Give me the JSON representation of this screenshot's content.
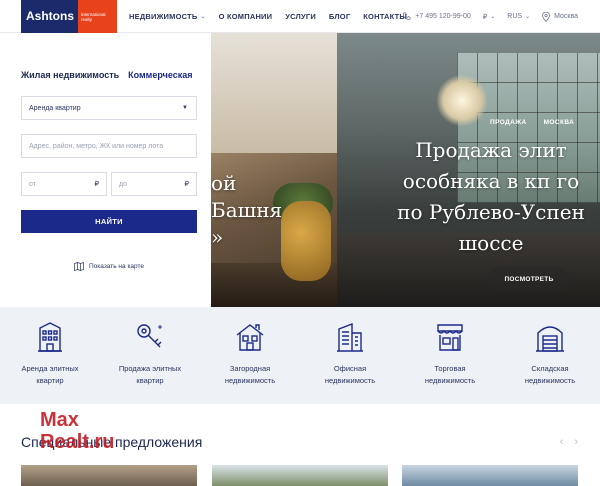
{
  "logo": {
    "name": "Ashtons",
    "tagline": "international realty"
  },
  "nav": [
    {
      "label": "НЕДВИЖИМОСТЬ",
      "dropdown": true
    },
    {
      "label": "О КОМПАНИИ",
      "dropdown": false
    },
    {
      "label": "УСЛУГИ",
      "dropdown": false
    },
    {
      "label": "БЛОГ",
      "dropdown": false
    },
    {
      "label": "КОНТАКТЫ",
      "dropdown": false
    }
  ],
  "header": {
    "phone": "+7 495 120-99-00",
    "currency": "₽",
    "language": "RUS",
    "city": "Москва"
  },
  "search": {
    "tab_residential": "Жилая недвижимость",
    "tab_commercial": "Коммерческая",
    "type_value": "Аренда квартир",
    "address_placeholder": "Адрес, район, метро, ЖК или номер лота",
    "from_placeholder": "от",
    "to_placeholder": "до",
    "currency": "₽",
    "submit": "НАЙТИ",
    "map_link": "Показать на карте"
  },
  "hero": {
    "left_lines": [
      "ой",
      "Башня",
      "»"
    ],
    "tag_deal": "ПРОДАЖА",
    "tag_city": "МОСКВА",
    "title_lines": [
      "Продажа элит",
      "особняка в кп го",
      "по Рублево-Успен",
      "шоссе"
    ],
    "button": "ПОСМОТРЕТЬ"
  },
  "categories": [
    {
      "line1": "Аренда элитных",
      "line2": "квартир",
      "icon": "apartment-building-icon"
    },
    {
      "line1": "Продажа элитных",
      "line2": "квартир",
      "icon": "key-icon"
    },
    {
      "line1": "Загородная",
      "line2": "недвижимость",
      "icon": "house-icon"
    },
    {
      "line1": "Офисная",
      "line2": "недвижимость",
      "icon": "office-building-icon"
    },
    {
      "line1": "Торговая",
      "line2": "недвижимость",
      "icon": "storefront-icon"
    },
    {
      "line1": "Складская",
      "line2": "недвижимость",
      "icon": "warehouse-icon"
    }
  ],
  "special": {
    "title": "Специальные предложения",
    "prev": "‹",
    "next": "›"
  },
  "watermark": {
    "line1": "Max",
    "line2": "Realt.ru"
  },
  "colors": {
    "brand_blue": "#1b2a8a",
    "logo_navy": "#1b2a6b",
    "logo_orange": "#e8421b",
    "strip_bg": "#eef1f6"
  }
}
